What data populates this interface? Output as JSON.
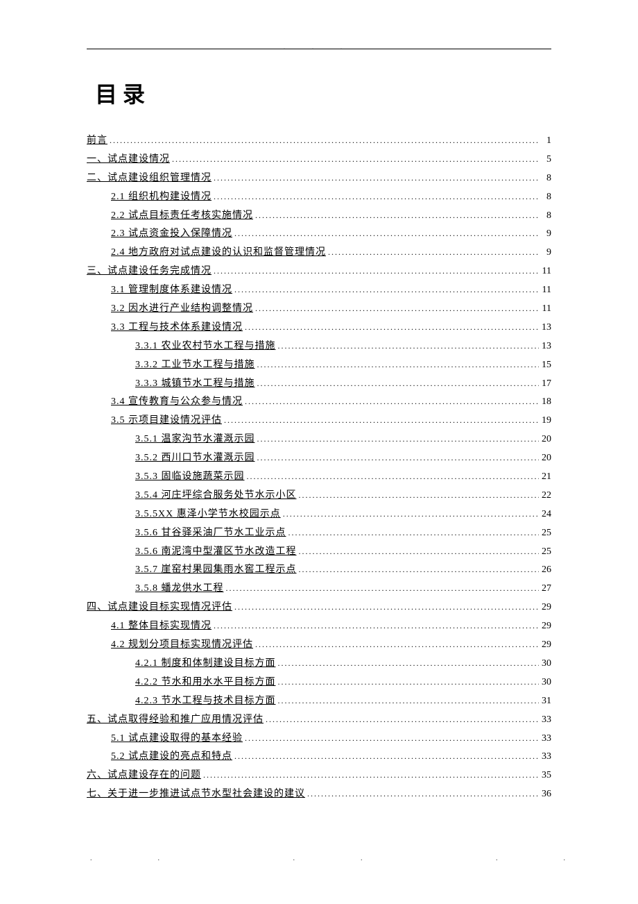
{
  "title": "目录",
  "entries": [
    {
      "text": "前言",
      "page": "1",
      "level": 0
    },
    {
      "text": "一、试点建设情况",
      "page": "5",
      "level": 0
    },
    {
      "text": "二、试点建设组织管理情况",
      "page": "8",
      "level": 0
    },
    {
      "text": "2.1 组织机构建设情况",
      "page": "8",
      "level": 1
    },
    {
      "text": "2.2 试点目标责任考核实施情况",
      "page": "8",
      "level": 1
    },
    {
      "text": "2.3 试点资金投入保障情况",
      "page": "9",
      "level": 1
    },
    {
      "text": "2.4 地方政府对试点建设的认识和监督管理情况",
      "page": "9",
      "level": 1
    },
    {
      "text": "三、试点建设任务完成情况",
      "page": "11",
      "level": 0
    },
    {
      "text": "3.1 管理制度体系建设情况",
      "page": "11",
      "level": 1
    },
    {
      "text": "3.2 因水进行产业结构调整情况",
      "page": "11",
      "level": 1
    },
    {
      "text": "3.3 工程与技术体系建设情况",
      "page": "13",
      "level": 1
    },
    {
      "text": "3.3.1 农业农村节水工程与措施",
      "page": "13",
      "level": 2
    },
    {
      "text": "3.3.2 工业节水工程与措施",
      "page": "15",
      "level": 2
    },
    {
      "text": "3.3.3 城镇节水工程与措施",
      "page": "17",
      "level": 2
    },
    {
      "text": "3.4 宣传教育与公众参与情况",
      "page": "18",
      "level": 1
    },
    {
      "text": "3.5 示项目建设情况评估",
      "page": "19",
      "level": 1
    },
    {
      "text": "3.5.1 温家沟节水灌溉示园",
      "page": "20",
      "level": 2
    },
    {
      "text": "3.5.2 西川口节水灌溉示园",
      "page": "20",
      "level": 2
    },
    {
      "text": "3.5.3 固临设施蔬菜示园",
      "page": "21",
      "level": 2
    },
    {
      "text": "3.5.4 河庄坪综合服务处节水示小区",
      "page": "22",
      "level": 2
    },
    {
      "text": "3.5.5XX 惠泽小学节水校园示点",
      "page": "24",
      "level": 2
    },
    {
      "text": "3.5.6 甘谷驿采油厂节水工业示点",
      "page": "25",
      "level": 2
    },
    {
      "text": "3.5.6 南泥湾中型灌区节水改造工程",
      "page": "25",
      "level": 2
    },
    {
      "text": "3.5.7 崖窑村果园集雨水窖工程示点",
      "page": "26",
      "level": 2
    },
    {
      "text": "3.5.8 蟠龙供水工程",
      "page": "27",
      "level": 2
    },
    {
      "text": "四、试点建设目标实现情况评估",
      "page": "29",
      "level": 0
    },
    {
      "text": "4.1 整体目标实现情况",
      "page": "29",
      "level": 1
    },
    {
      "text": "4.2 规划分项目标实现情况评估",
      "page": "29",
      "level": 1
    },
    {
      "text": "4.2.1 制度和体制建设目标方面",
      "page": "30",
      "level": 2
    },
    {
      "text": "4.2.2 节水和用水水平目标方面",
      "page": "30",
      "level": 2
    },
    {
      "text": "4.2.3 节水工程与技术目标方面",
      "page": "31",
      "level": 2
    },
    {
      "text": "五、试点取得经验和推广应用情况评估",
      "page": "33",
      "level": 0
    },
    {
      "text": "5.1 试点建设取得的基本经验",
      "page": "33",
      "level": 1
    },
    {
      "text": "5.2 试点建设的亮点和特点",
      "page": "33",
      "level": 1
    },
    {
      "text": "六、试点建设存在的问题",
      "page": "35",
      "level": 0
    },
    {
      "text": "七、关于进一步推进试点节水型社会建设的建议",
      "page": "36",
      "level": 0
    }
  ]
}
